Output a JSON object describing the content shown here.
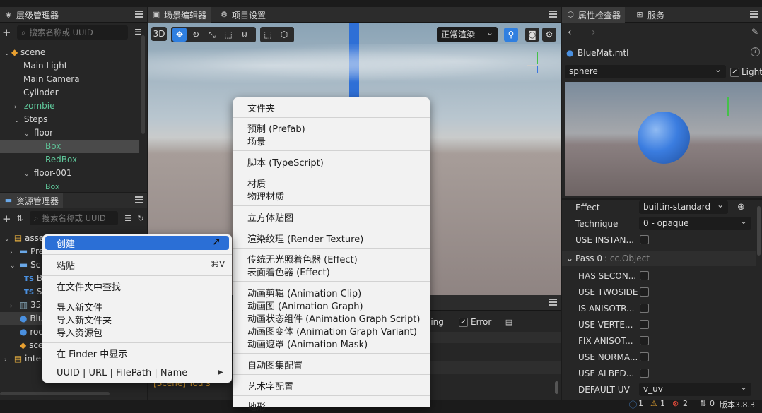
{
  "hierarchy": {
    "title": "层级管理器",
    "search_placeholder": "搜索名称或 UUID",
    "rows": [
      {
        "label": "scene"
      },
      {
        "label": "Main Light"
      },
      {
        "label": "Main Camera"
      },
      {
        "label": "Cylinder"
      },
      {
        "label": "zombie"
      },
      {
        "label": "Steps"
      },
      {
        "label": "floor"
      },
      {
        "label": "Box"
      },
      {
        "label": "RedBox"
      },
      {
        "label": "floor-001"
      },
      {
        "label": "Box"
      }
    ]
  },
  "scene_tabs": {
    "editor": "场景编辑器",
    "settings": "项目设置"
  },
  "scene_toolbar": {
    "mode_3d": "3D",
    "render_mode": "正常渲染"
  },
  "assets": {
    "title": "资源管理器",
    "search_placeholder": "搜索名称或 UUID",
    "rows": [
      {
        "label": "asse"
      },
      {
        "label": "Pre"
      },
      {
        "label": "Sc"
      },
      {
        "label": "B"
      },
      {
        "label": "S"
      },
      {
        "label": "35"
      },
      {
        "label": "Blu"
      },
      {
        "label": "roo"
      },
      {
        "label": "sce"
      },
      {
        "label": "inter"
      }
    ],
    "ts_badge": "TS"
  },
  "console": {
    "warning_label": "rning",
    "error_label": "Error",
    "log_text": "[Scene] You s"
  },
  "context_menu": {
    "items": [
      {
        "label": "创建"
      },
      {
        "label": "粘贴",
        "shortcut": "⌘V"
      },
      {
        "label": "在文件夹中查找"
      },
      {
        "label": "导入新文件"
      },
      {
        "label": "导入新文件夹"
      },
      {
        "label": "导入资源包"
      },
      {
        "label": "在 Finder 中显示"
      },
      {
        "label": "UUID | URL | FilePath | Name"
      }
    ]
  },
  "create_submenu": {
    "items": [
      {
        "label": "文件夹"
      },
      {
        "label": "预制 (Prefab)"
      },
      {
        "label": "场景"
      },
      {
        "label": "脚本 (TypeScript)"
      },
      {
        "label": "材质"
      },
      {
        "label": "物理材质"
      },
      {
        "label": "立方体贴图"
      },
      {
        "label": "渲染纹理 (Render Texture)"
      },
      {
        "label": "传统无光照着色器 (Effect)"
      },
      {
        "label": "表面着色器 (Effect)"
      },
      {
        "label": "动画剪辑 (Animation Clip)"
      },
      {
        "label": "动画图 (Animation Graph)"
      },
      {
        "label": "动画状态组件 (Animation Graph Script)"
      },
      {
        "label": "动画图变体 (Animation Graph Variant)"
      },
      {
        "label": "动画遮罩 (Animation Mask)"
      },
      {
        "label": "自动图集配置"
      },
      {
        "label": "艺术字配置"
      },
      {
        "label": "地形"
      }
    ]
  },
  "inspector": {
    "tab_inspector": "属性检查器",
    "tab_services": "服务",
    "asset_name": "BlueMat.mtl",
    "preview_shape": "sphere",
    "preview_light": "Light",
    "effect_label": "Effect",
    "effect_value": "builtin-standard",
    "technique_label": "Technique",
    "technique_value": "0 - opaque",
    "use_instancing": "USE INSTAN...",
    "pass_label": "Pass 0",
    "pass_type": ": cc.Object",
    "defines": [
      {
        "label": "HAS SECON..."
      },
      {
        "label": "USE TWOSIDE"
      },
      {
        "label": "IS ANISOTR..."
      },
      {
        "label": "USE VERTE..."
      },
      {
        "label": "FIX ANISOT..."
      },
      {
        "label": "USE NORMA..."
      },
      {
        "label": "USE ALBED..."
      }
    ],
    "default_uv_label": "DEFAULT UV",
    "default_uv_value": "v_uv"
  },
  "status_bar": {
    "info_count": "1",
    "warn_count": "1",
    "error_count": "2",
    "other_count": "0",
    "version": "版本3.8.3"
  },
  "colors": {
    "accent": "#2f7fe0",
    "menu_highlight": "#2b6fd6",
    "green_node": "#5fc79a",
    "sphere": "#3b7de0"
  }
}
